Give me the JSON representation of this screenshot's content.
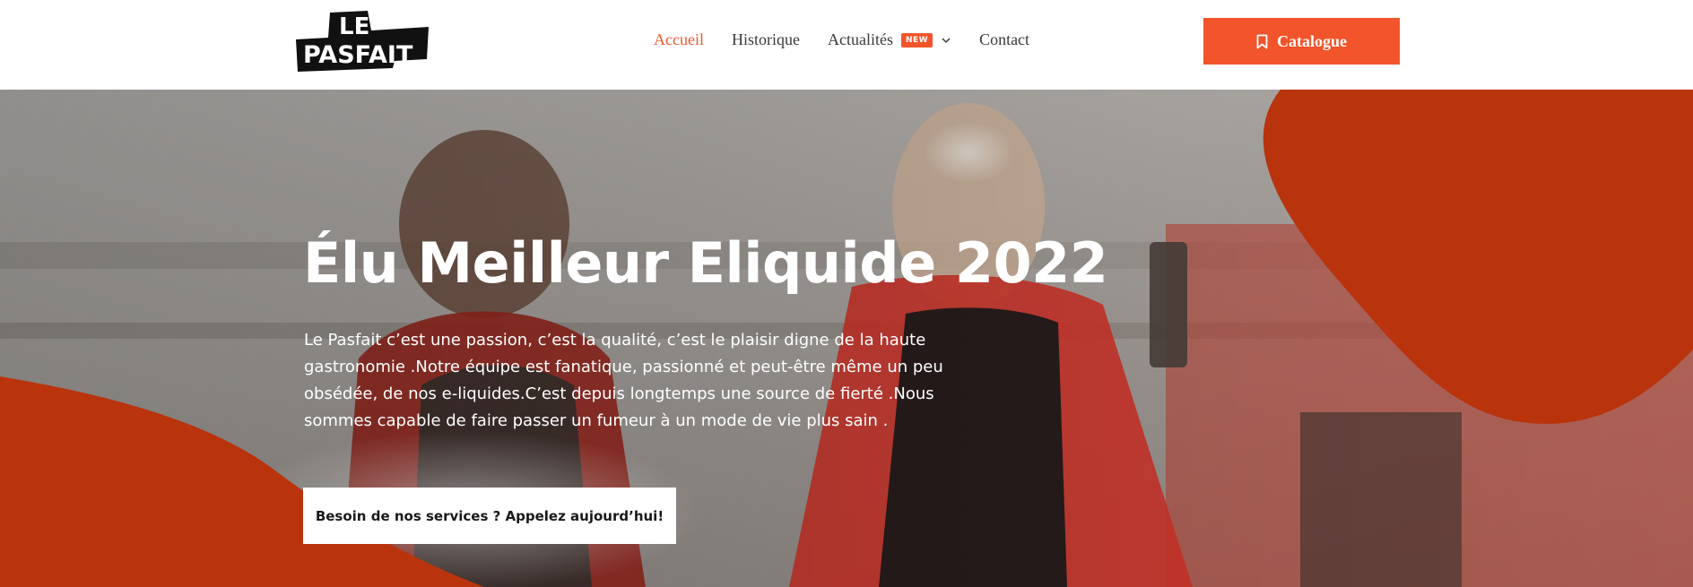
{
  "header": {
    "logo": {
      "line1": "LE",
      "line2": "PASFAIT"
    },
    "nav": [
      {
        "label": "Accueil",
        "active": true
      },
      {
        "label": "Historique",
        "active": false
      },
      {
        "label": "Actualités",
        "active": false,
        "badge": "NEW",
        "has_dropdown": true
      },
      {
        "label": "Contact",
        "active": false
      }
    ],
    "cta": {
      "label": "Catalogue",
      "icon": "bookmark-icon"
    }
  },
  "hero": {
    "title": "Élu Meilleur Eliquide 2022",
    "text": "Le Pasfait c’est une passion, c’est la qualité, c’est le plaisir digne de la haute gastronomie .Notre équipe est fanatique, passionné et peut-être même un peu obsédée, de nos e-liquides.C’est depuis longtemps une source de fierté .Nous sommes capable de faire passer un fumeur à un mode de vie plus sain .",
    "button_label": "Besoin de nos services ? Appelez aujourd’hui!"
  },
  "colors": {
    "accent": "#f2552c",
    "dark_orange": "#b9330d",
    "nav_text": "#3a3a3a",
    "white": "#ffffff"
  }
}
